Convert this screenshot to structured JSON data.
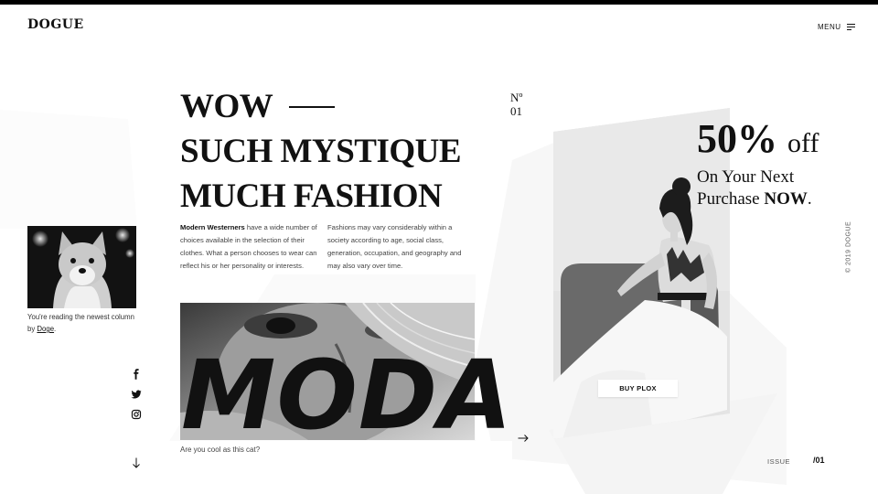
{
  "brand": {
    "logo": "DOGUE"
  },
  "nav": {
    "menu_label": "MENU",
    "menu_icon": "hamburger-icon"
  },
  "headline": {
    "line1": "WOW",
    "line2": "SUCH MYSTIQUE",
    "line3": "MUCH FASHION"
  },
  "issue_marker": {
    "prefix": "Nº",
    "number": "01"
  },
  "article": {
    "col1_bold": "Modern Westerners",
    "col1_rest": " have a wide number of choices available in the selection of their clothes. What a person chooses to wear can reflect his or her personality or interests.",
    "col2": "Fashions may vary considerably within a society according to age, social class, generation, occupation, and geography and may also vary over time."
  },
  "author": {
    "caption_prefix": "You're reading the newest column by ",
    "name": "Doge",
    "caption_suffix": "."
  },
  "social": {
    "icons": [
      "facebook-icon",
      "twitter-icon",
      "instagram-icon"
    ]
  },
  "feature": {
    "word": "MODA",
    "caption": "Are you cool as this cat?"
  },
  "promo": {
    "percent": "50%",
    "off": "off",
    "line2": "On Your Next",
    "line3_pre": "Purchase ",
    "line3_bold": "NOW",
    "line3_post": "."
  },
  "cta": {
    "buy_label": "BUY PLOX"
  },
  "footer": {
    "copyright": "© 2019 DOGUE",
    "issue_label": "ISSUE",
    "issue_number": "/01"
  },
  "colors": {
    "ink": "#111111",
    "background": "#ffffff",
    "muted": "#555555",
    "shape": "#f6f6f6"
  }
}
